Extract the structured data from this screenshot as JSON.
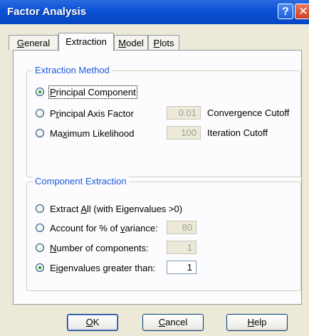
{
  "window": {
    "title": "Factor Analysis",
    "help_glyph": "?",
    "close_glyph": "✕"
  },
  "tabs": [
    {
      "label": "General",
      "mnemonic": "G",
      "rest": "eneral",
      "active": false
    },
    {
      "label": "Extraction",
      "mnemonic": "",
      "rest": "Extraction",
      "active": true
    },
    {
      "label": "Model",
      "mnemonic": "M",
      "rest": "odel",
      "active": false
    },
    {
      "label": "Plots",
      "mnemonic": "P",
      "rest": "lots",
      "active": false
    }
  ],
  "extraction_method": {
    "legend": "Extraction Method",
    "options": [
      {
        "pre": "",
        "mn": "P",
        "post": "rincipal Component",
        "selected": true
      },
      {
        "pre": "P",
        "mn": "r",
        "post": "incipal Axis Factor",
        "selected": false
      },
      {
        "pre": "Ma",
        "mn": "x",
        "post": "imum Likelihood",
        "selected": false
      }
    ],
    "convergence_value": "0.01",
    "convergence_label": "Convergence Cutoff",
    "iteration_value": "100",
    "iteration_label": "Iteration Cutoff"
  },
  "component_extraction": {
    "legend": "Component Extraction",
    "options": [
      {
        "pre": "Extract ",
        "mn": "A",
        "post": "ll (with Eigenvalues >0)",
        "selected": false,
        "value": ""
      },
      {
        "pre": "Account for % of ",
        "mn": "v",
        "post": "ariance:",
        "selected": false,
        "value": "80"
      },
      {
        "pre": "",
        "mn": "N",
        "post": "umber of components:",
        "selected": false,
        "value": "1"
      },
      {
        "pre": "E",
        "mn": "i",
        "post": "genvalues greater than:",
        "selected": true,
        "value": "1"
      }
    ]
  },
  "buttons": {
    "ok": {
      "mn": "O",
      "post": "K"
    },
    "cancel": {
      "mn": "C",
      "post": "ancel"
    },
    "help": {
      "mn": "H",
      "post": "elp"
    }
  }
}
